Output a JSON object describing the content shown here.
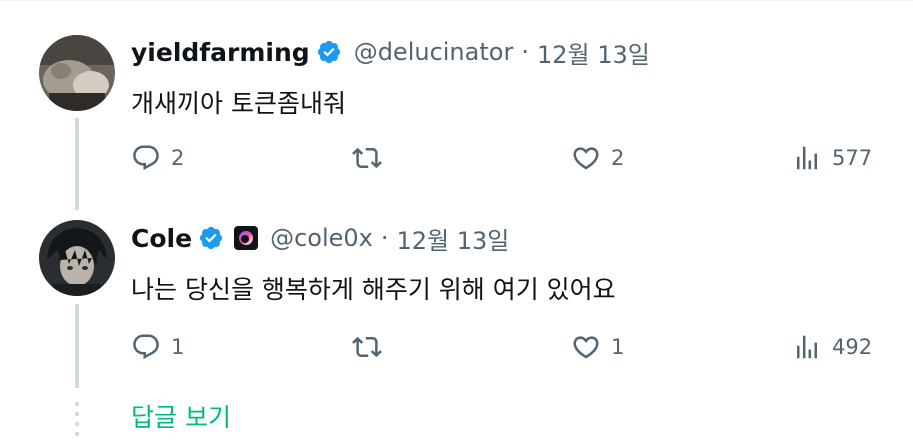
{
  "tweets": [
    {
      "name": "yieldfarming",
      "handle": "@delucinator",
      "separator": "·",
      "date": "12월 13일",
      "text": "개새끼아 토큰좀내줘",
      "replies": "2",
      "retweets": "",
      "likes": "2",
      "views": "577",
      "verified": true,
      "has_affiliation_badge": false
    },
    {
      "name": "Cole",
      "handle": "@cole0x",
      "separator": "·",
      "date": "12월 13일",
      "text": "나는 당신을 행복하게 해주기 위해 여기 있어요",
      "replies": "1",
      "retweets": "",
      "likes": "1",
      "views": "492",
      "verified": true,
      "has_affiliation_badge": true
    }
  ],
  "show_replies_label": "답글 보기",
  "colors": {
    "verified_blue": "#1d9bf0",
    "muted_text": "#536471",
    "show_replies_green": "#00ba7c",
    "thread_line": "#cfd9de"
  },
  "icons": [
    "reply-icon",
    "retweet-icon",
    "like-icon",
    "views-icon",
    "verified-badge-icon",
    "affiliation-badge-icon"
  ]
}
